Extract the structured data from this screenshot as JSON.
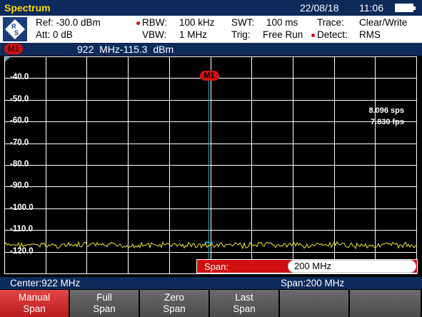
{
  "title_bar": {
    "app_title": "Spectrum",
    "date": "22/08/18",
    "time": "11:06"
  },
  "settings": {
    "ref": "Ref:  -30.0 dBm",
    "att": "Att:  0 dB",
    "rbw_label": "RBW:",
    "rbw_value": "100 kHz",
    "vbw_label": "VBW:",
    "vbw_value": "1 MHz",
    "swt_label": "SWT:",
    "swt_value": "100 ms",
    "trig_label": "Trig:",
    "trig_value": "Free Run",
    "trace_label": "Trace:",
    "trace_value": "Clear/Write",
    "detect_label": "Detect:",
    "detect_value": "RMS"
  },
  "marker_bar": {
    "tag": "M1",
    "readout": "922  MHz-115.3  dBm"
  },
  "plot": {
    "y_labels": [
      "-40.0",
      "-50.0",
      "-60.0",
      "-70.0",
      "-80.0",
      "-90.0",
      "-100.0",
      "-110.0",
      "-120.0"
    ],
    "rate_sps": "8.096 sps",
    "rate_fps": "7.830 fps",
    "marker_label": "M1",
    "colors": {
      "trace": "#e8e82a",
      "grid": "#ffffff",
      "marker_line": "#2aa8c8",
      "marker": "#d01010"
    }
  },
  "span_input": {
    "label": "Span:",
    "value": "200 MHz"
  },
  "status": {
    "center": "Center:922 MHz",
    "span": "Span:200 MHz"
  },
  "softkeys": [
    {
      "line1": "Manual",
      "line2": "Span",
      "active": true
    },
    {
      "line1": "Full",
      "line2": "Span",
      "active": false
    },
    {
      "line1": "Zero",
      "line2": "Span",
      "active": false
    },
    {
      "line1": "Last",
      "line2": "Span",
      "active": false
    },
    {
      "line1": "",
      "line2": "",
      "active": false
    },
    {
      "line1": "",
      "line2": "",
      "active": false
    }
  ]
}
